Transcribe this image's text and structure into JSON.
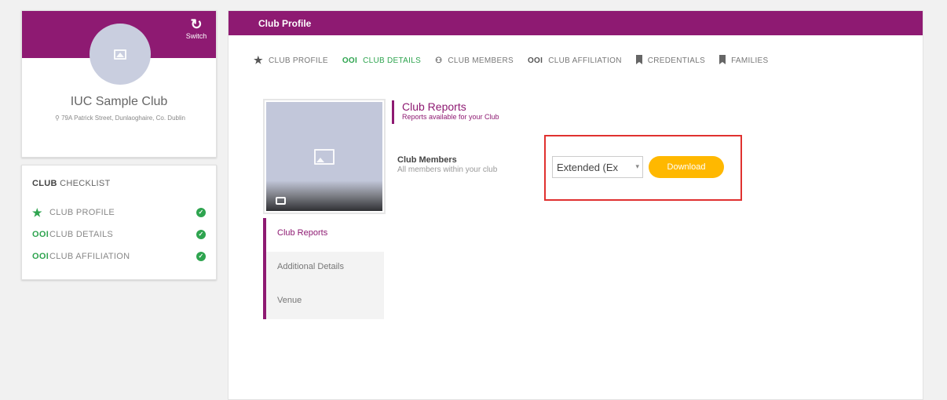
{
  "profile": {
    "switch_label": "Switch",
    "club_name": "IUC Sample Club",
    "club_address": "79A Patrick Street, Dunlaoghaire, Co. Dublin"
  },
  "checklist": {
    "title_bold": "CLUB",
    "title_rest": " CHECKLIST",
    "items": [
      {
        "icon": "★",
        "label": "CLUB PROFILE"
      },
      {
        "icon": "OOI",
        "label": "CLUB DETAILS"
      },
      {
        "icon": "OOI",
        "label": "CLUB AFFILIATION"
      }
    ]
  },
  "main": {
    "header": "Club Profile",
    "tabs": [
      {
        "icon": "★",
        "label": "CLUB PROFILE"
      },
      {
        "icon": "OOI",
        "label": "CLUB DETAILS"
      },
      {
        "icon": "⚇",
        "label": "CLUB MEMBERS"
      },
      {
        "icon": "OOI",
        "label": "CLUB AFFILIATION"
      },
      {
        "icon": "bookmark",
        "label": "CREDENTIALS"
      },
      {
        "icon": "bookmark",
        "label": "FAMILIES"
      }
    ],
    "side_nav": [
      "Club Reports",
      "Additional Details",
      "Venue"
    ],
    "reports": {
      "title": "Club Reports",
      "subtitle": "Reports available for your Club",
      "members_title": "Club Members",
      "members_subtitle": "All members within your club",
      "select_value": "Extended (Ex",
      "download_label": "Download"
    }
  },
  "colors": {
    "brand": "#8e1a72",
    "success": "#2ea44f",
    "download": "#ffb800",
    "highlight": "#e0312f"
  }
}
